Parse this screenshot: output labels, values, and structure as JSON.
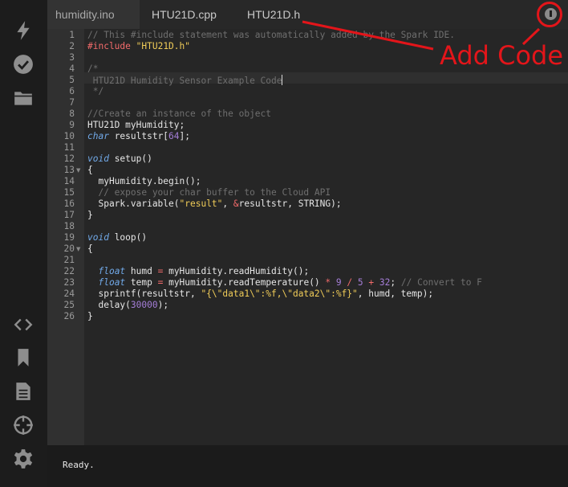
{
  "sidebar": {
    "top_icons": [
      "flash-icon",
      "verify-check-icon",
      "folder-icon"
    ],
    "bottom_icons": [
      "code-icon",
      "bookmark-icon",
      "document-icon",
      "target-icon",
      "gear-icon"
    ]
  },
  "tabs": [
    {
      "label": "humidity.ino",
      "active": true
    },
    {
      "label": "HTU21D.cpp",
      "active": false
    },
    {
      "label": "HTU21D.h",
      "active": false
    }
  ],
  "line_numbers": [
    "1",
    "2",
    "3",
    "4",
    "5",
    "6",
    "7",
    "8",
    "9",
    "10",
    "11",
    "12",
    "13",
    "14",
    "15",
    "16",
    "17",
    "18",
    "19",
    "20",
    "21",
    "22",
    "23",
    "24",
    "25",
    "26"
  ],
  "code_lines": [
    "// This #include statement was automatically added by the Spark IDE.",
    "#include \"HTU21D.h\"",
    "",
    "/*",
    " HTU21D Humidity Sensor Example Code",
    " */",
    "",
    "//Create an instance of the object",
    "HTU21D myHumidity;",
    "char resultstr[64];",
    "",
    "void setup()",
    "{",
    "  myHumidity.begin();",
    "  // expose your char buffer to the Cloud API",
    "  Spark.variable(\"result\", &resultstr, STRING);",
    "}",
    "",
    "void loop()",
    "{",
    "",
    "  float humd = myHumidity.readHumidity();",
    "  float temp = myHumidity.readTemperature() * 9 / 5 + 32; // Convert to F",
    "  sprintf(resultstr, \"{\\\"data1\\\":%f,\\\"data2\\\":%f}\", humd, temp);",
    "  delay(30000);",
    "}"
  ],
  "status": {
    "text": "Ready."
  },
  "annotation": {
    "label": "Add Code",
    "color": "#e3151a"
  },
  "colors": {
    "comment": "#6f6f6f",
    "preprocessor": "#f36b6b",
    "string": "#f0cc58",
    "keyword": "#71a9e8",
    "number": "#a57ed8"
  }
}
